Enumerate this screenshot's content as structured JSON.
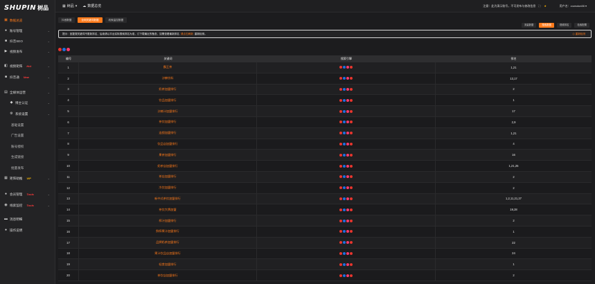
{
  "brand": {
    "logo_text": "SHUPIN",
    "logo_cn": "树品"
  },
  "header": {
    "crumb1": "树品",
    "crumb2": "数据总览",
    "notice": "注意：此为演示账号，不可发布与修改信息",
    "user": "用户名：zowsdun88"
  },
  "sidebar": {
    "items": [
      {
        "label": "数据总览",
        "icon": "dashboard-icon",
        "active": true
      },
      {
        "label": "账号管理",
        "icon": "user-icon"
      },
      {
        "label": "抖音SEO",
        "icon": "seo-icon"
      },
      {
        "label": "视频发布",
        "icon": "video-icon"
      },
      {
        "label": "视频矩阵",
        "icon": "matrix-icon",
        "tag": "Hot"
      },
      {
        "label": "抖音通",
        "icon": "douyin-icon",
        "tag": "New"
      },
      {
        "label": "全媒体运营",
        "icon": "media-icon"
      },
      {
        "label": "博主认证",
        "icon": "badge-icon"
      },
      {
        "label": "系统设置",
        "icon": "gear-icon"
      },
      {
        "label": "基础设置"
      },
      {
        "label": "广告设置"
      },
      {
        "label": "账号授权"
      },
      {
        "label": "生成链接"
      },
      {
        "label": "批量发布"
      },
      {
        "label": "矩阵助推",
        "icon": "boost-icon",
        "tag": "VIP"
      },
      {
        "label": "会员管理",
        "icon": "member-icon",
        "tag": "Tools"
      },
      {
        "label": "线索监控",
        "icon": "monitor-icon",
        "tag": "Tools"
      },
      {
        "label": "消息明细",
        "icon": "message-icon"
      },
      {
        "label": "操作说明",
        "icon": "help-icon"
      }
    ]
  },
  "tabs": [
    "抖音数据",
    "全网关键词数据",
    "线索监控数据"
  ],
  "right_tabs": [
    "流量数据",
    "搜索数据",
    "视频排名",
    "检索配置"
  ],
  "alert": {
    "text": "提示：回复搜关键词不更新排名，后续请以平台实际搜索排名为准，订下载最近的备查，如需查看最新排名",
    "highlight": "请点击刷新",
    "tail": "重新检测。",
    "right": "◎ 重新检测"
  },
  "table": {
    "headers": [
      "编号",
      "关键词",
      "搜索引擎",
      "排名"
    ],
    "rows": [
      {
        "no": "1",
        "kw": "霸王茶",
        "rank": "1,21"
      },
      {
        "no": "2",
        "kw": "沙棘饮料",
        "rank": "13,17"
      },
      {
        "no": "3",
        "kw": "奶茶加盟排行",
        "rank": "2"
      },
      {
        "no": "4",
        "kw": "饮品加盟排行",
        "rank": "1"
      },
      {
        "no": "5",
        "kw": "沙棘汁加盟排行",
        "rank": "17"
      },
      {
        "no": "6",
        "kw": "茶饮加盟排行",
        "rank": "2,9"
      },
      {
        "no": "7",
        "kw": "连锁加盟排行",
        "rank": "1,21"
      },
      {
        "no": "8",
        "kw": "饮品店加盟排行",
        "rank": "4"
      },
      {
        "no": "9",
        "kw": "果茶加盟排行",
        "rank": "16"
      },
      {
        "no": "10",
        "kw": "奶茶店加盟排行",
        "rank": "1,21,25"
      },
      {
        "no": "11",
        "kw": "茶店加盟排行",
        "rank": "2"
      },
      {
        "no": "12",
        "kw": "冷饮加盟排行",
        "rank": "2"
      },
      {
        "no": "13",
        "kw": "新中式茶饮加盟排行",
        "rank": "1,2,11,21,27"
      },
      {
        "no": "14",
        "kw": "茶饮大牌加盟",
        "rank": "19,28"
      },
      {
        "no": "15",
        "kw": "榨汁加盟排行",
        "rank": "2"
      },
      {
        "no": "16",
        "kw": "鲜榨果汁加盟排行",
        "rank": "1"
      },
      {
        "no": "17",
        "kw": "品牌奶茶加盟排行",
        "rank": "22"
      },
      {
        "no": "18",
        "kw": "果汁饮品店加盟排行",
        "rank": "24"
      },
      {
        "no": "19",
        "kw": "轻食加盟排行",
        "rank": "1"
      },
      {
        "no": "20",
        "kw": "茶饮店加盟排行",
        "rank": "2"
      }
    ]
  },
  "colors": {
    "accent": "#ff7a1a",
    "bg": "#1c1c1e",
    "sidebar": "#232325"
  }
}
